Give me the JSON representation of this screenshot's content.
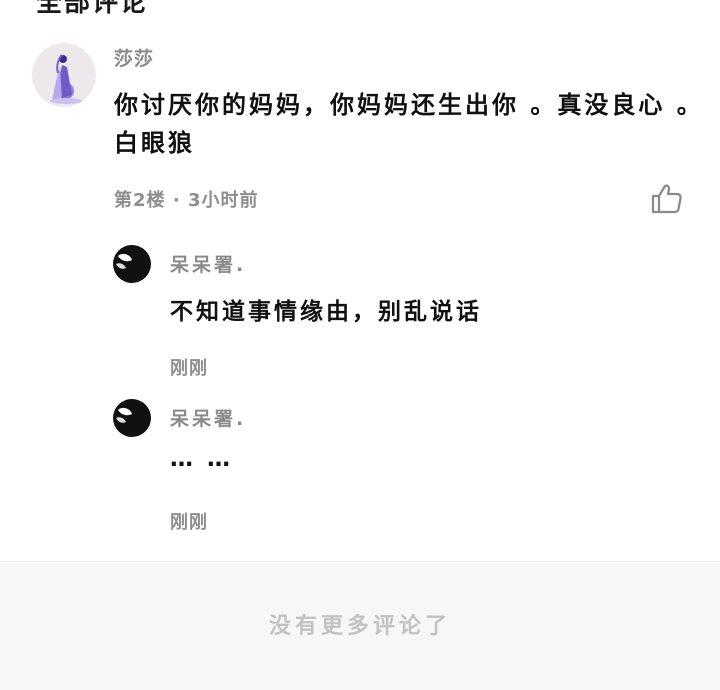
{
  "section": {
    "title": "全部评论"
  },
  "comment": {
    "username": "莎莎",
    "text": "你讨厌你的妈妈，你妈妈还生出你 。真没良心 。白眼狼",
    "floor": "第2楼",
    "separator": "·",
    "time": "3小时前",
    "like_icon": "thumbs-up-icon"
  },
  "replies": [
    {
      "username": "呆呆署.",
      "text": "不知道事情缘由，别乱说话",
      "time": "刚刚"
    },
    {
      "username": "呆呆署.",
      "text": "… …",
      "time": "刚刚"
    }
  ],
  "footer": {
    "text": "没有更多评论了"
  },
  "colors": {
    "text_primary": "#111111",
    "text_secondary": "#8a8a8a",
    "footer_bg": "#f7f7f7",
    "footer_text": "#c2c2c2"
  }
}
